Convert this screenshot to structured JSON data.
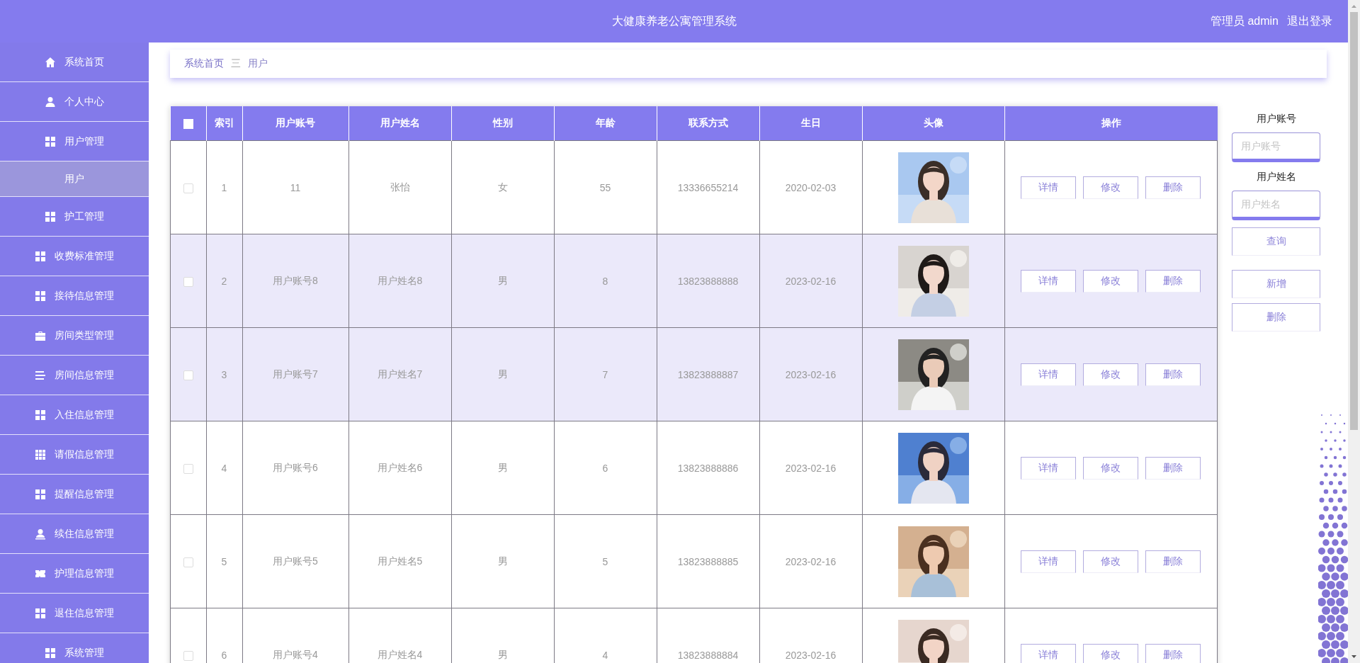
{
  "header": {
    "title": "大健康养老公寓管理系统",
    "user": "管理员 admin",
    "logout": "退出登录"
  },
  "sidebar": {
    "items": [
      {
        "label": "系统首页",
        "selected": false
      },
      {
        "label": "个人中心",
        "selected": false
      },
      {
        "label": "用户管理",
        "selected": false,
        "children": [
          {
            "label": "用户",
            "selected": true
          }
        ]
      },
      {
        "label": "护工管理",
        "selected": false
      },
      {
        "label": "收费标准管理",
        "selected": false
      },
      {
        "label": "接待信息管理",
        "selected": false
      },
      {
        "label": "房间类型管理",
        "selected": false
      },
      {
        "label": "房间信息管理",
        "selected": false
      },
      {
        "label": "入住信息管理",
        "selected": false
      },
      {
        "label": "请假信息管理",
        "selected": false
      },
      {
        "label": "提醒信息管理",
        "selected": false
      },
      {
        "label": "续住信息管理",
        "selected": false
      },
      {
        "label": "护理信息管理",
        "selected": false
      },
      {
        "label": "退住信息管理",
        "selected": false
      },
      {
        "label": "系统管理",
        "selected": false
      }
    ]
  },
  "breadcrumb": {
    "items": [
      "系统首页",
      "用户"
    ],
    "separator": "三"
  },
  "table": {
    "select_all": {
      "checked": false
    },
    "columns": [
      "索引",
      "用户账号",
      "用户姓名",
      "性别",
      "年龄",
      "联系方式",
      "生日",
      "头像",
      "操作"
    ],
    "rows": [
      {
        "checked": false,
        "highlighted": false,
        "cells": [
          "1",
          "11",
          "张怡",
          "女",
          "55",
          "13336655214",
          "2020-02-03"
        ],
        "actions": [
          "详情",
          "修改",
          "删除"
        ]
      },
      {
        "checked": false,
        "highlighted": true,
        "cells": [
          "2",
          "用户账号8",
          "用户姓名8",
          "男",
          "8",
          "13823888888",
          "2023-02-16"
        ],
        "actions": [
          "详情",
          "修改",
          "删除"
        ]
      },
      {
        "checked": false,
        "highlighted": true,
        "cells": [
          "3",
          "用户账号7",
          "用户姓名7",
          "男",
          "7",
          "13823888887",
          "2023-02-16"
        ],
        "actions": [
          "详情",
          "修改",
          "删除"
        ]
      },
      {
        "checked": false,
        "highlighted": false,
        "cells": [
          "4",
          "用户账号6",
          "用户姓名6",
          "男",
          "6",
          "13823888886",
          "2023-02-16"
        ],
        "actions": [
          "详情",
          "修改",
          "删除"
        ]
      },
      {
        "checked": false,
        "highlighted": false,
        "cells": [
          "5",
          "用户账号5",
          "用户姓名5",
          "男",
          "5",
          "13823888885",
          "2023-02-16"
        ],
        "actions": [
          "详情",
          "修改",
          "删除"
        ]
      },
      {
        "checked": false,
        "highlighted": false,
        "cells": [
          "6",
          "用户账号4",
          "用户姓名4",
          "男",
          "4",
          "13823888884",
          "2023-02-16"
        ],
        "actions": [
          "详情",
          "修改",
          "删除"
        ]
      }
    ]
  },
  "search": {
    "fields": [
      {
        "label": "用户账号",
        "placeholder": "用户账号"
      },
      {
        "label": "用户姓名",
        "placeholder": "用户姓名"
      }
    ],
    "query_button": "查询",
    "actions": [
      "新增",
      "删除"
    ]
  }
}
